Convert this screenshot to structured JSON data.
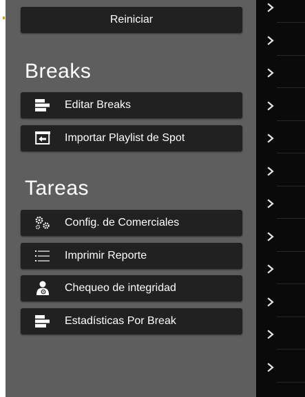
{
  "toolbar": {
    "reset_label": "Reiniciar"
  },
  "sections": [
    {
      "title": "Breaks",
      "items": [
        {
          "label": "Editar Breaks",
          "icon": "bars-icon"
        },
        {
          "label": "Importar Playlist de Spot",
          "icon": "import-icon"
        }
      ]
    },
    {
      "title": "Tareas",
      "items": [
        {
          "label": "Config. de Comerciales",
          "icon": "gears-icon"
        },
        {
          "label": "Imprimir Reporte",
          "icon": "list-icon"
        },
        {
          "label": "Chequeo de integridad",
          "icon": "user-check-icon"
        },
        {
          "label": "Estadísticas Por Break",
          "icon": "bars-icon"
        }
      ]
    }
  ],
  "right_column": {
    "chevron_icon": "chevron-right-icon",
    "chevron_count": 12
  },
  "colors": {
    "panel": "#5e5e5e",
    "button": "#212121",
    "text": "#ffffff",
    "right_column": "#0a0a0a"
  }
}
